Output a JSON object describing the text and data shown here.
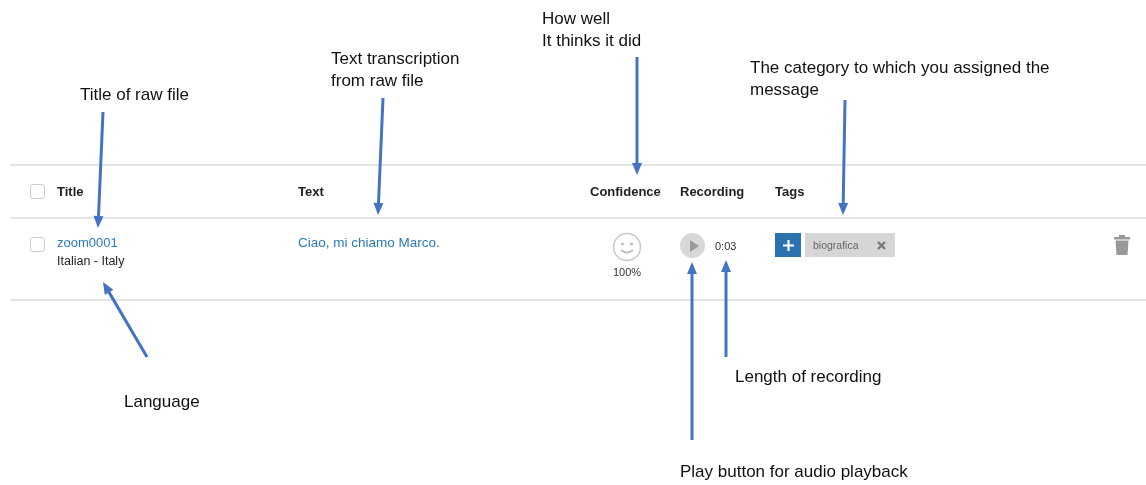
{
  "table": {
    "select_all": {
      "checked": false
    },
    "columns": [
      "Title",
      "Text",
      "Confidence",
      "Recording",
      "Tags"
    ],
    "rows": [
      {
        "checked": false,
        "title": "zoom0001",
        "language": "Italian - Italy",
        "text": "Ciao, mi chiamo Marco.",
        "confidence": "100%",
        "duration": "0:03",
        "tags": [
          "biografica"
        ]
      }
    ]
  },
  "annotations": [
    {
      "lines": [
        "Title of raw file"
      ]
    },
    {
      "lines": [
        "Text transcription",
        "from raw file"
      ]
    },
    {
      "lines": [
        "How well",
        "It thinks it did"
      ]
    },
    {
      "lines": [
        "The category to which you assigned the",
        "message"
      ]
    },
    {
      "lines": [
        "Language"
      ]
    },
    {
      "lines": [
        "Length of recording"
      ]
    },
    {
      "lines": [
        "Play button for audio playback"
      ]
    }
  ]
}
